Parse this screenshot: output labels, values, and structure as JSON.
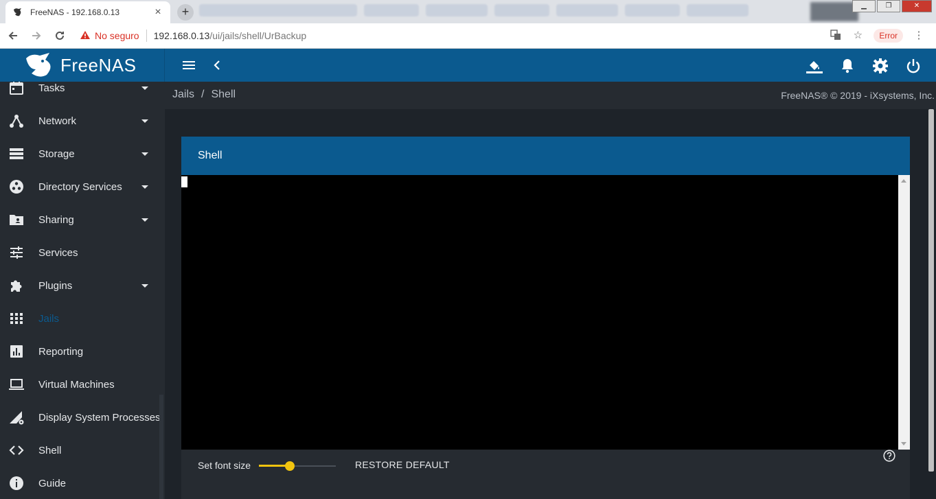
{
  "browser": {
    "tab_title": "FreeNAS - 192.168.0.13",
    "new_tab": "+",
    "security_label": "No seguro",
    "url_host": "192.168.0.13",
    "url_path": "/ui/jails/shell/UrBackup",
    "error_label": "Error"
  },
  "header": {
    "logo_text": "FreeNAS"
  },
  "breadcrumb": {
    "items": [
      "Jails",
      "Shell"
    ],
    "separator": "/"
  },
  "copyright": "FreeNAS® © 2019 - iXsystems, Inc.",
  "sidebar": {
    "items": [
      {
        "label": "Tasks",
        "icon": "calendar-icon",
        "expandable": true
      },
      {
        "label": "Network",
        "icon": "network-icon",
        "expandable": true
      },
      {
        "label": "Storage",
        "icon": "storage-icon",
        "expandable": true
      },
      {
        "label": "Directory Services",
        "icon": "directory-services-icon",
        "expandable": true
      },
      {
        "label": "Sharing",
        "icon": "sharing-folder-icon",
        "expandable": true
      },
      {
        "label": "Services",
        "icon": "tune-icon",
        "expandable": false
      },
      {
        "label": "Plugins",
        "icon": "puzzle-icon",
        "expandable": true
      },
      {
        "label": "Jails",
        "icon": "apps-grid-icon",
        "expandable": false,
        "active": true
      },
      {
        "label": "Reporting",
        "icon": "chart-icon",
        "expandable": false
      },
      {
        "label": "Virtual Machines",
        "icon": "laptop-icon",
        "expandable": false
      },
      {
        "label": "Display System Processes",
        "icon": "system-processes-icon",
        "expandable": false
      },
      {
        "label": "Shell",
        "icon": "code-icon",
        "expandable": false
      },
      {
        "label": "Guide",
        "icon": "info-icon",
        "expandable": false
      }
    ]
  },
  "shell_card": {
    "title": "Shell",
    "font_size_label": "Set font size",
    "font_size_fraction": 0.4,
    "restore_label": "RESTORE DEFAULT"
  },
  "colors": {
    "brand_blue": "#0b5a8f",
    "sidebar_bg": "#262b31",
    "slider_accent": "#f1c40f"
  }
}
